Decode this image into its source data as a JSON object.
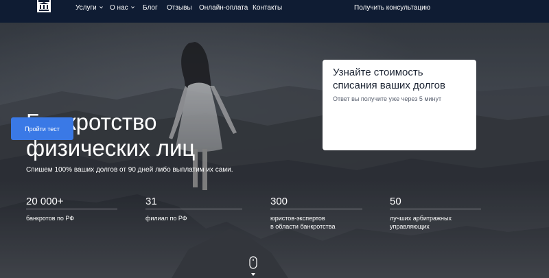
{
  "header": {
    "nav": [
      {
        "label": "Услуги",
        "has_dropdown": true
      },
      {
        "label": "О нас",
        "has_dropdown": true
      },
      {
        "label": "Блог",
        "has_dropdown": false
      },
      {
        "label": "Отзывы",
        "has_dropdown": false
      },
      {
        "label": "Онлайн-оплата",
        "has_dropdown": false
      },
      {
        "label": "Контакты",
        "has_dropdown": false
      }
    ],
    "cta_label": "Получить консультацию"
  },
  "hero": {
    "title": "Банкротство физических лиц",
    "subtitle": "Спишем 100% ваших долгов от 90 дней либо выплатим их сами."
  },
  "stats": [
    {
      "value": "20 000+",
      "label": "банкротов по РФ"
    },
    {
      "value": "31",
      "label": "филиал по РФ"
    },
    {
      "value": "300",
      "label": "юристов-экспертов\nв области банкротства"
    },
    {
      "value": "50",
      "label": "лучших арбитражных\nуправляющих"
    }
  ],
  "card": {
    "title": "Узнайте стоимость списания ваших долгов",
    "subtitle": "Ответ вы получите уже через 5 минут",
    "button_label": "Пройти тест"
  },
  "icons": {
    "logo": "building-columns-logo",
    "dropdown": "chevron-down-icon",
    "scroll": "mouse-scroll-icon"
  },
  "colors": {
    "header_bg": "#0f1c33",
    "button": "#3a79e6",
    "card_bg": "#ffffff"
  }
}
